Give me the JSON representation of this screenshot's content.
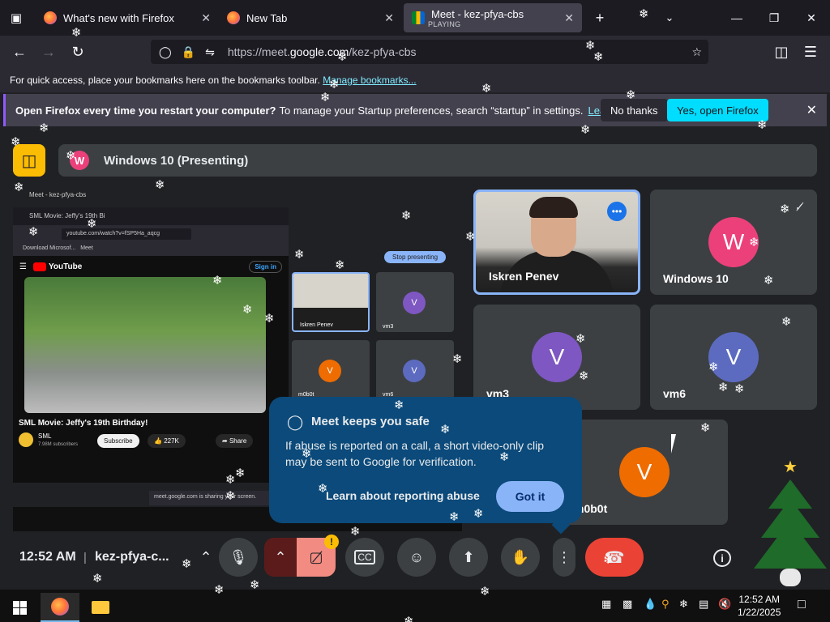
{
  "browser": {
    "tabs": [
      {
        "title": "What's new with Firefox",
        "icon": "firefox-icon"
      },
      {
        "title": "New Tab",
        "icon": "firefox-icon"
      },
      {
        "title": "Meet - kez-pfya-cbs",
        "subtitle": "PLAYING",
        "icon": "google-meet-icon",
        "active": true
      }
    ],
    "url_prefix": "https://meet.",
    "url_domain": "google.com",
    "url_path": "/kez-pfya-cbs",
    "bookmarks_text": "For quick access, place your bookmarks here on the bookmarks toolbar.",
    "bookmarks_link": "Manage bookmarks...",
    "notification": {
      "bold": "Open Firefox every time you restart your computer?",
      "text": "To manage your Startup preferences, search “startup” in settings.",
      "link": "Learn more",
      "no_button": "No thanks",
      "yes_button": "Yes, open Firefox"
    }
  },
  "meet": {
    "presenting_label": "Windows 10 (Presenting)",
    "presenting_avatar": "W",
    "shared_screen": {
      "mini_tab": "Meet - kez-pfya-cbs",
      "yt_tab": "SML Movie: Jeffy's 19th Bi",
      "yt_url": "youtube.com/watch?v=fSP5Ha_aqcg",
      "bookmark_1": "Download Microsof...",
      "bookmark_2": "Meet",
      "youtube_brand": "YouTube",
      "sign_in": "Sign in",
      "video_title": "SML Movie: Jeffy's 19th Birthday!",
      "channel": "SML",
      "subscribers": "7.98M subscribers",
      "subscribe": "Subscribe",
      "likes": "227K",
      "share": "Share",
      "sharing_note": "meet.google.com is sharing your screen.",
      "stop_presenting": "Stop presenting",
      "mini_tiles": [
        {
          "name": "Iskren Penev",
          "letter": ""
        },
        {
          "name": "vm3",
          "letter": "V",
          "color": "#7e57c2"
        },
        {
          "name": "m0b0t",
          "letter": "V",
          "color": "#ef6c00"
        },
        {
          "name": "vm6",
          "letter": "V",
          "color": "#5c6bc0"
        }
      ]
    },
    "tiles": [
      {
        "name": "Iskren Penev",
        "type": "camera"
      },
      {
        "name": "Windows 10",
        "letter": "W",
        "color": "#ec407a",
        "muted": true
      },
      {
        "name": "vm3",
        "letter": "V",
        "color": "#7e57c2"
      },
      {
        "name": "vm6",
        "letter": "V",
        "color": "#5c6bc0"
      },
      {
        "name": "m0b0t",
        "letter": "V",
        "color": "#ef6c00"
      }
    ],
    "safety_popup": {
      "title": "Meet keeps you safe",
      "text": "If abuse is reported on a call, a short video-only clip may be sent to Google for verification.",
      "link": "Learn about reporting abuse",
      "button": "Got it"
    },
    "controls": {
      "time": "12:52 AM",
      "meeting_code": "kez-pfya-c...",
      "warning_badge": "!"
    }
  },
  "taskbar": {
    "time": "12:52 AM",
    "date": "1/22/2025"
  }
}
